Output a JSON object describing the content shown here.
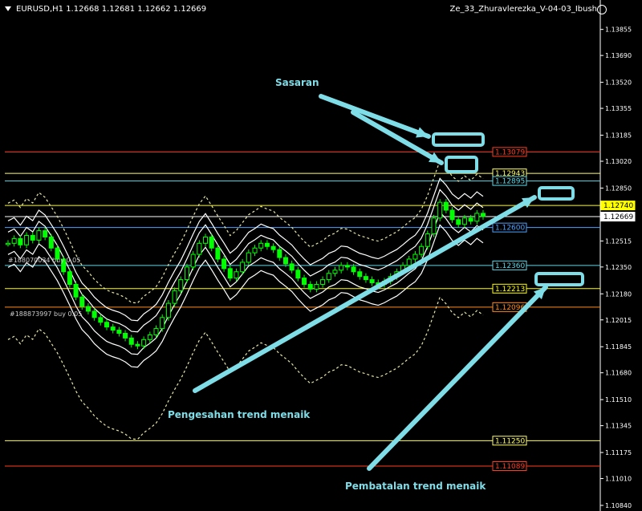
{
  "header": {
    "symbol_info": "EURUSD,H1  1.12668 1.12681 1.12662 1.12669",
    "ea_name": "Ze_33_Zhuravlerezka_V-04-03_Ibush"
  },
  "icons": [
    "chevron-down-icon",
    "smiley-icon"
  ],
  "orders": [
    {
      "label": "#188070034 buy 0.05"
    },
    {
      "label": "#188873997 buy 0.05"
    }
  ],
  "annotations": [
    {
      "text": "Sasaran"
    },
    {
      "text": "Pengesahan trend menaik"
    },
    {
      "text": "Pembatalan trend menaik"
    }
  ],
  "colors": {
    "background": "#000000",
    "candles": "#00ff00",
    "annotation": "#7fdde8"
  },
  "chart_data": {
    "type": "candlestick",
    "symbol": "EURUSD",
    "timeframe": "H1",
    "ohlc_current": {
      "open": 1.12668,
      "high": 1.12681,
      "low": 1.12662,
      "close": 1.12669
    },
    "ylim": [
      1.1084,
      1.1396
    ],
    "y_ticks": [
      "1.13855",
      "1.13690",
      "1.13520",
      "1.13355",
      "1.13185",
      "1.13020",
      "1.12850",
      "1.12680",
      "1.12515",
      "1.12350",
      "1.12180",
      "1.12015",
      "1.11845",
      "1.11680",
      "1.11510",
      "1.11345",
      "1.11175",
      "1.11010",
      "1.10840"
    ],
    "price_levels": [
      {
        "label": "1.13079",
        "value": 1.13079,
        "color": "#ff3b1e"
      },
      {
        "label": "1.12943",
        "value": 1.12943,
        "color": "#ffff66"
      },
      {
        "label": "1.12895",
        "value": 1.12895,
        "color": "#5bd6e6"
      },
      {
        "label": "1.12740",
        "value": 1.1274,
        "color": "#ffff00"
      },
      {
        "label": "1.12669",
        "value": 1.12669,
        "color": "#ffffff"
      },
      {
        "label": "1.12600",
        "value": 1.126,
        "color": "#4aa3ff"
      },
      {
        "label": "1.12360",
        "value": 1.1236,
        "color": "#5bd6e6"
      },
      {
        "label": "1.12213",
        "value": 1.12213,
        "color": "#ffff00"
      },
      {
        "label": "1.12096",
        "value": 1.12096,
        "color": "#ff8c1a"
      },
      {
        "label": "1.11250",
        "value": 1.1125,
        "color": "#ffff66"
      },
      {
        "label": "1.11089",
        "value": 1.11089,
        "color": "#ff3b1e"
      }
    ],
    "series": [
      {
        "values": [
          1.125,
          1.1253,
          1.1249,
          1.1255,
          1.1252,
          1.1258,
          1.1254,
          1.1247,
          1.124,
          1.1232,
          1.1224,
          1.1216,
          1.121,
          1.1207,
          1.1203,
          1.12,
          1.1197,
          1.1195,
          1.1193,
          1.119,
          1.1186,
          1.1185,
          1.1189,
          1.1192,
          1.1196,
          1.1203,
          1.1212,
          1.122,
          1.1227,
          1.1235,
          1.1243,
          1.125,
          1.1254,
          1.1247,
          1.124,
          1.1234,
          1.1228,
          1.1232,
          1.1238,
          1.1244,
          1.1247,
          1.125,
          1.1248,
          1.1246,
          1.1241,
          1.1237,
          1.1233,
          1.1228,
          1.1224,
          1.1221,
          1.1224,
          1.1227,
          1.1231,
          1.1233,
          1.1236,
          1.1235,
          1.1232,
          1.1229,
          1.1227,
          1.1225,
          1.1224,
          1.1226,
          1.1229,
          1.1232,
          1.1236,
          1.124,
          1.1243,
          1.1248,
          1.1256,
          1.1266,
          1.1276,
          1.1271,
          1.1265,
          1.1262,
          1.1266,
          1.1264,
          1.1269,
          1.1267
        ]
      }
    ]
  }
}
